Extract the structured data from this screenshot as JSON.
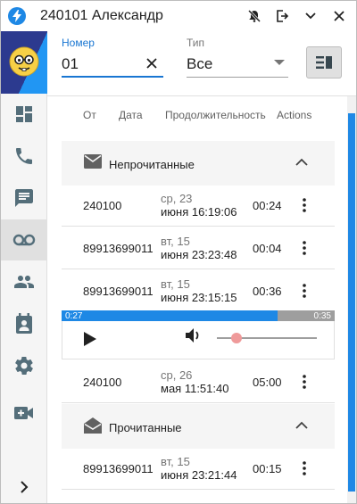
{
  "window": {
    "title": "240101 Александр"
  },
  "icons": {
    "app": "lightning-icon",
    "mute": "bell-off-icon",
    "logout": "exit-icon",
    "minimize": "chevron-down-icon",
    "close": "close-icon"
  },
  "sidebar": {
    "items": [
      {
        "name": "dashboard",
        "icon": "dashboard-icon"
      },
      {
        "name": "calls",
        "icon": "phone-icon"
      },
      {
        "name": "messages",
        "icon": "message-icon"
      },
      {
        "name": "voicemail",
        "icon": "voicemail-icon",
        "active": true
      },
      {
        "name": "contacts",
        "icon": "people-icon"
      },
      {
        "name": "calendar",
        "icon": "calendar-person-icon"
      },
      {
        "name": "settings",
        "icon": "gear-icon"
      },
      {
        "name": "video",
        "icon": "video-add-icon"
      }
    ],
    "expand_icon": "chevron-right-icon"
  },
  "form": {
    "number_label": "Номер",
    "number_value": "01",
    "type_label": "Тип",
    "type_value": "Все"
  },
  "table": {
    "headers": {
      "from": "От",
      "date": "Дата",
      "duration": "Продолжительность",
      "actions": "Actions"
    }
  },
  "groups": {
    "unread_label": "Непрочитанные",
    "read_label": "Прочитанные"
  },
  "rows": [
    {
      "from": "240100",
      "weekday": "ср, 23",
      "date": "июня 16:19:06",
      "duration": "00:24"
    },
    {
      "from": "89913699011",
      "weekday": "вт, 15",
      "date": "июня 23:23:48",
      "duration": "00:04"
    },
    {
      "from": "89913699011",
      "weekday": "вт, 15",
      "date": "июня 23:15:15",
      "duration": "00:36"
    },
    {
      "from": "240100",
      "weekday": "ср, 26",
      "date": "мая 11:51:40",
      "duration": "05:00"
    },
    {
      "from": "89913699011",
      "weekday": "вт, 15",
      "date": "июня 23:21:44",
      "duration": "00:15"
    }
  ],
  "player": {
    "elapsed": "0:27",
    "total": "0:35",
    "progress_fraction": 0.79,
    "volume_fraction": 0.2
  },
  "colors": {
    "accent": "#1e88e5",
    "accent_dark": "#1976d2",
    "volume_knob": "#ef9a9a"
  }
}
